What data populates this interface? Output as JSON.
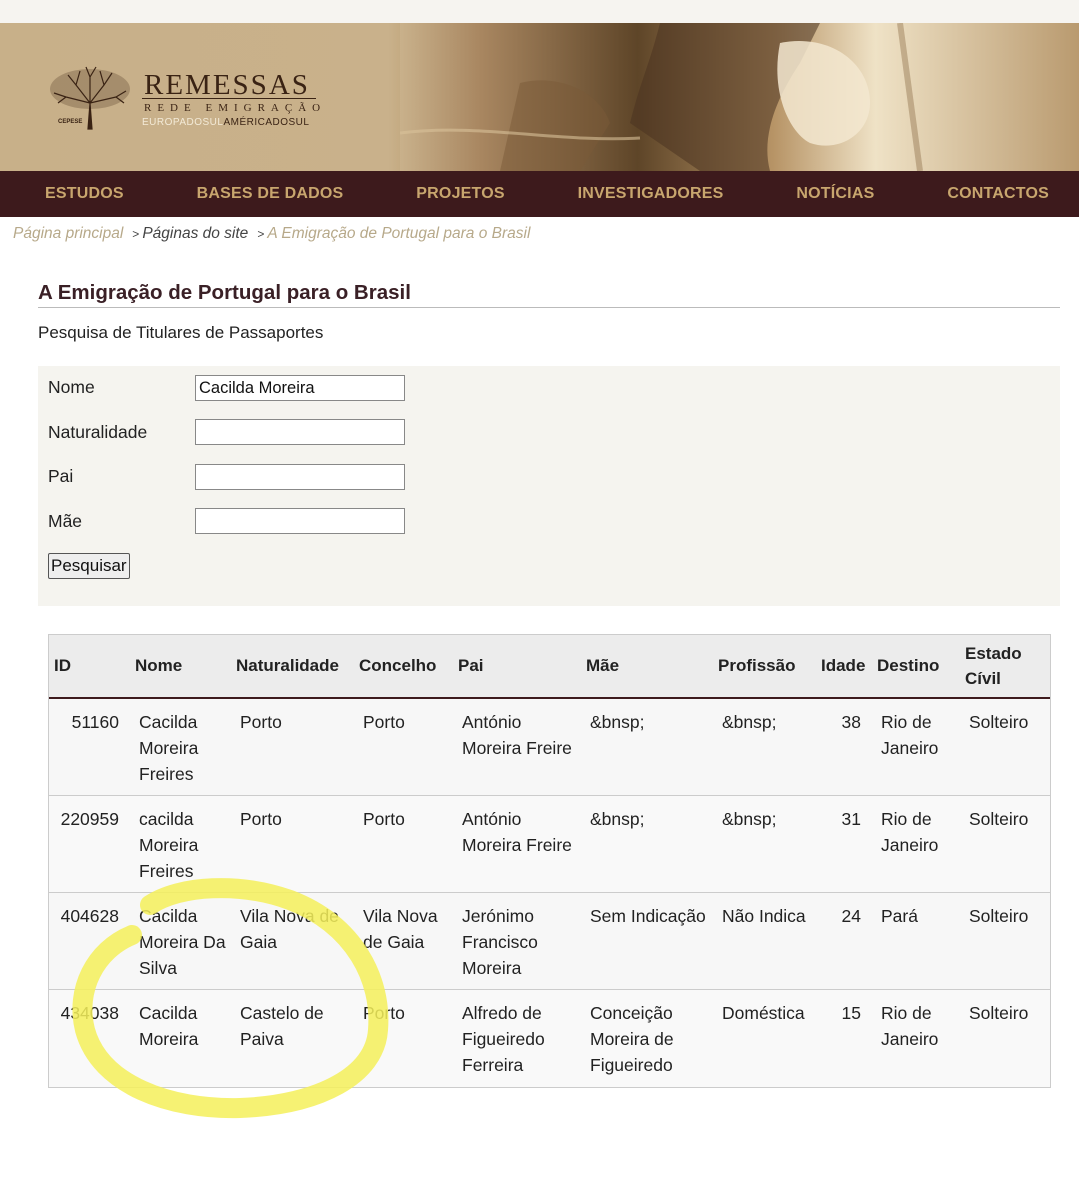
{
  "header": {
    "logo_title": "REMESSAS",
    "logo_sub": "REDE EMIGRAÇÃO",
    "logo_sub2_a": "EUROPADOSUL",
    "logo_sub2_b": "AMÉRICADOSUL",
    "logo_org": "CEPESE"
  },
  "nav": {
    "items": [
      "ESTUDOS",
      "BASES DE DADOS",
      "PROJETOS",
      "INVESTIGADORES",
      "NOTÍCIAS",
      "CONTACTOS"
    ]
  },
  "breadcrumb": {
    "home": "Página principal",
    "sep": ">",
    "pages": "Páginas do site",
    "current": "A Emigração de Portugal para o Brasil"
  },
  "page": {
    "title": "A Emigração de Portugal para o Brasil",
    "subtitle": "Pesquisa de Titulares de Passaportes"
  },
  "form": {
    "fields": [
      {
        "label": "Nome",
        "value": "Cacilda Moreira"
      },
      {
        "label": "Naturalidade",
        "value": ""
      },
      {
        "label": "Pai",
        "value": ""
      },
      {
        "label": "Mãe",
        "value": ""
      }
    ],
    "submit_label": "Pesquisar"
  },
  "results": {
    "headers": [
      "ID",
      "Nome",
      "Naturalidade",
      "Concelho",
      "Pai",
      "Mãe",
      "Profissão",
      "Idade",
      "Destino",
      "Estado Cívil"
    ],
    "rows": [
      [
        "51160",
        "Cacilda Moreira Freires",
        "Porto",
        "Porto",
        "António Moreira Freire",
        "&bnsp;",
        "&bnsp;",
        "38",
        "Rio de Janeiro",
        "Solteiro"
      ],
      [
        "220959",
        "cacilda Moreira Freires",
        "Porto",
        "Porto",
        "António Moreira Freire",
        "&bnsp;",
        "&bnsp;",
        "31",
        "Rio de Janeiro",
        "Solteiro"
      ],
      [
        "404628",
        "Cacilda Moreira Da Silva",
        "Vila Nova de Gaia",
        "Vila Nova de Gaia",
        "Jerónimo Francisco Moreira",
        "Sem Indicação",
        "Não Indica",
        "24",
        "Pará",
        "Solteiro"
      ],
      [
        "434038",
        "Cacilda Moreira",
        "Castelo de Paiva",
        "Porto",
        "Alfredo de Figueiredo Ferreira",
        "Conceição Moreira de Figueiredo",
        "Doméstica",
        "15",
        "Rio de Janeiro",
        "Solteiro"
      ]
    ]
  },
  "colors": {
    "nav_bg": "#3d1a1c",
    "nav_text": "#c8a66e",
    "highlight": "#f5f05a"
  }
}
